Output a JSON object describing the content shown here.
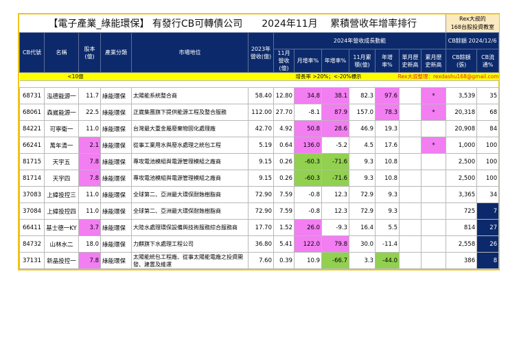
{
  "title": "【電子產業_綠能環保】 有發行CB可轉債公司　　2024年11月　 累積營收年增率排行",
  "rex_badge": [
    "Rex大叔的",
    "168台股投資教室"
  ],
  "headers": {
    "code": "CB代號",
    "name": "名稱",
    "capital": "股本(億)",
    "industry": "產業分類",
    "market": "市場地位",
    "rev2023": "2023年營收(億)",
    "group2024": "2024年營收成長動能",
    "cb_group": "CB餘額 2024/12/6",
    "nov_rev": "11月營收(億)",
    "mom": "月增率%",
    "yoy": "年增率%",
    "nov_cum": "11月累積(億)",
    "cum_yoy": "年增率%",
    "month_high": "單月歷史新高",
    "cum_high": "累月歷史新高",
    "cb_balance": "CB餘額(張)",
    "cb_float": "CB流通%"
  },
  "legend": {
    "small_cap": "<10億",
    "rule": "增長率 >20%；<-20%標示",
    "credit": "Rex大叔整理：rexdashu168@gmail.com"
  },
  "colors": {
    "positive": "#f27ef2",
    "negative": "#92d050",
    "low_float": "#0c2a6b",
    "header": "#0c2a6b",
    "border": "#f0c419",
    "legend": "#ffff00"
  },
  "rows": [
    {
      "code": "68731",
      "name": "泓德能源一",
      "capital": "11.7",
      "industry": "綠能環保",
      "market": "太陽能系統整合商",
      "rev2023": "58.40",
      "nov_rev": "12.80",
      "mom": "34.8",
      "yoy": "38.1",
      "cum": "82.3",
      "cum_yoy": "97.6",
      "mh": "",
      "ch": "*",
      "cb": "3,539",
      "fl": "35",
      "hl": {
        "mom": "pk",
        "yoy": "pk",
        "cum_yoy": "pk",
        "ch": "pk"
      }
    },
    {
      "code": "68061",
      "name": "森崴能源一",
      "capital": "22.5",
      "industry": "綠能環保",
      "market": "正崴集團旗下提供能源工程及整合服務",
      "rev2023": "112.00",
      "nov_rev": "27.70",
      "mom": "-8.1",
      "yoy": "87.9",
      "cum": "157.0",
      "cum_yoy": "78.3",
      "mh": "",
      "ch": "*",
      "cb": "20,318",
      "fl": "68",
      "hl": {
        "yoy": "pk",
        "cum_yoy": "pk",
        "ch": "pk"
      }
    },
    {
      "code": "84221",
      "name": "可寧衛一",
      "capital": "11.0",
      "industry": "綠能環保",
      "market": "台灣最大重金屬廢棄物固化處理廠",
      "rev2023": "42.70",
      "nov_rev": "4.92",
      "mom": "50.8",
      "yoy": "28.6",
      "cum": "46.9",
      "cum_yoy": "19.3",
      "mh": "",
      "ch": "",
      "cb": "20,908",
      "fl": "84",
      "hl": {
        "mom": "pk",
        "yoy": "pk"
      }
    },
    {
      "code": "66241",
      "name": "萬年清一",
      "capital": "2.1",
      "industry": "綠能環保",
      "market": "從事工業用水與廢水處理之統包工程",
      "rev2023": "5.19",
      "nov_rev": "0.64",
      "mom": "136.0",
      "yoy": "-5.2",
      "cum": "4.5",
      "cum_yoy": "17.6",
      "mh": "",
      "ch": "*",
      "cb": "1,000",
      "fl": "100",
      "hl": {
        "capital": "pk",
        "mom": "pk",
        "ch": "pk"
      }
    },
    {
      "code": "81715",
      "name": "天宇五",
      "capital": "7.8",
      "industry": "綠能環保",
      "market": "專攻電池模組與電源管理模組之廠商",
      "rev2023": "9.15",
      "nov_rev": "0.26",
      "mom": "-60.3",
      "yoy": "-71.6",
      "cum": "9.3",
      "cum_yoy": "10.8",
      "mh": "",
      "ch": "",
      "cb": "2,500",
      "fl": "100",
      "hl": {
        "capital": "pk",
        "mom": "gr",
        "yoy": "gr"
      }
    },
    {
      "code": "81714",
      "name": "天宇四",
      "capital": "7.8",
      "industry": "綠能環保",
      "market": "專攻電池模組與電源管理模組之廠商",
      "rev2023": "9.15",
      "nov_rev": "0.26",
      "mom": "-60.3",
      "yoy": "-71.6",
      "cum": "9.3",
      "cum_yoy": "10.8",
      "mh": "",
      "ch": "",
      "cb": "2,500",
      "fl": "100",
      "hl": {
        "capital": "pk",
        "mom": "gr",
        "yoy": "gr"
      }
    },
    {
      "code": "37083",
      "name": "上緯投控三",
      "capital": "11.0",
      "industry": "綠能環保",
      "market": "全球第二、亞洲最大環保耐蝕樹脂商",
      "rev2023": "72.90",
      "nov_rev": "7.59",
      "mom": "-0.8",
      "yoy": "12.3",
      "cum": "72.9",
      "cum_yoy": "9.3",
      "mh": "",
      "ch": "",
      "cb": "3,365",
      "fl": "34",
      "hl": {}
    },
    {
      "code": "37084",
      "name": "上緯投控四",
      "capital": "11.0",
      "industry": "綠能環保",
      "market": "全球第二、亞洲最大環保耐蝕樹脂商",
      "rev2023": "72.90",
      "nov_rev": "7.59",
      "mom": "-0.8",
      "yoy": "12.3",
      "cum": "72.9",
      "cum_yoy": "9.3",
      "mh": "",
      "ch": "",
      "cb": "725",
      "fl": "7",
      "hl": {
        "fl": "nv"
      }
    },
    {
      "code": "66411",
      "name": "基士德一KY",
      "capital": "3.7",
      "industry": "綠能環保",
      "market": "大陸水處理環保設備與技術服務綜合服務商",
      "rev2023": "17.70",
      "nov_rev": "1.52",
      "mom": "26.0",
      "yoy": "-9.3",
      "cum": "16.4",
      "cum_yoy": "5.5",
      "mh": "",
      "ch": "",
      "cb": "814",
      "fl": "27",
      "hl": {
        "capital": "pk",
        "mom": "pk",
        "fl": "nv"
      }
    },
    {
      "code": "84732",
      "name": "山林水二",
      "capital": "18.0",
      "industry": "綠能環保",
      "market": "力麒旗下水處理工程公司",
      "rev2023": "36.80",
      "nov_rev": "5.41",
      "mom": "122.0",
      "yoy": "79.8",
      "cum": "30.0",
      "cum_yoy": "-11.4",
      "mh": "",
      "ch": "",
      "cb": "2,558",
      "fl": "26",
      "hl": {
        "mom": "pk",
        "yoy": "pk",
        "fl": "nv"
      }
    },
    {
      "code": "37131",
      "name": "新晶投控一",
      "capital": "7.8",
      "industry": "綠能環保",
      "market": "太陽能統包工程廠、從事太陽能電廠之投資開發、建置及維運",
      "rev2023": "7.60",
      "nov_rev": "0.39",
      "mom": "10.9",
      "yoy": "-66.7",
      "cum": "3.3",
      "cum_yoy": "-44.0",
      "mh": "",
      "ch": "",
      "cb": "386",
      "fl": "8",
      "hl": {
        "capital": "pk",
        "yoy": "gr",
        "cum_yoy": "gr",
        "fl": "nv"
      }
    }
  ]
}
